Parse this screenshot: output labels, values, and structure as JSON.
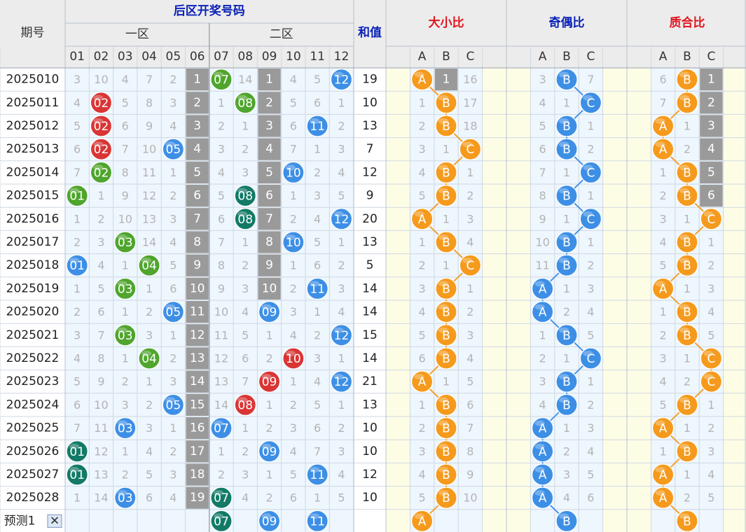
{
  "headers": {
    "period": "期号",
    "back_zone": "后区开奖号码",
    "zone1": "一区",
    "zone2": "二区",
    "sum": "和值",
    "size_ratio": "大小比",
    "parity_ratio": "奇偶比",
    "prime_ratio": "质合比",
    "numbers": [
      "01",
      "02",
      "03",
      "04",
      "05",
      "06",
      "07",
      "08",
      "09",
      "10",
      "11",
      "12"
    ],
    "abc": [
      "A",
      "B",
      "C"
    ]
  },
  "colors": {
    "blue": "#3d8fe6",
    "red": "#d93535",
    "green": "#4fa52d",
    "teal": "#127a66",
    "orange": "#f59a1c",
    "gray": "#9a9a9a"
  },
  "predict": {
    "label": "预测1",
    "close_symbol": "✕",
    "balls": [
      {
        "col": 7,
        "text": "07",
        "color": "teal"
      },
      {
        "col": 9,
        "text": "09",
        "color": "blue"
      },
      {
        "col": 11,
        "text": "11",
        "color": "blue"
      }
    ],
    "size": "A",
    "parity": "B",
    "prime": "B"
  },
  "chart_data": {
    "type": "table",
    "rows": [
      {
        "period": "2025010",
        "missing": [
          3,
          10,
          4,
          7,
          2,
          1,
          null,
          14,
          1,
          4,
          5,
          null
        ],
        "balls": [
          {
            "col": 7,
            "text": "07",
            "color": "green"
          },
          {
            "col": 12,
            "text": "12",
            "color": "blue"
          }
        ],
        "sum": 19,
        "size": {
          "pick": "A",
          "other": [
            1,
            16
          ]
        },
        "parity": {
          "pick": "B",
          "other": [
            3,
            7
          ]
        },
        "prime": {
          "pick": "B",
          "other": [
            6,
            1
          ]
        }
      },
      {
        "period": "2025011",
        "missing": [
          4,
          null,
          5,
          8,
          3,
          2,
          1,
          null,
          2,
          5,
          6,
          1
        ],
        "balls": [
          {
            "col": 2,
            "text": "02",
            "color": "red"
          },
          {
            "col": 8,
            "text": "08",
            "color": "green"
          }
        ],
        "sum": 10,
        "size": {
          "pick": "B",
          "other": [
            1,
            17
          ]
        },
        "parity": {
          "pick": "C",
          "other": [
            4,
            1
          ]
        },
        "prime": {
          "pick": "B",
          "other": [
            7,
            2
          ]
        }
      },
      {
        "period": "2025012",
        "missing": [
          5,
          null,
          6,
          9,
          4,
          3,
          2,
          1,
          3,
          6,
          null,
          2
        ],
        "balls": [
          {
            "col": 2,
            "text": "02",
            "color": "red"
          },
          {
            "col": 11,
            "text": "11",
            "color": "blue"
          }
        ],
        "sum": 13,
        "size": {
          "pick": "B",
          "other": [
            2,
            18
          ]
        },
        "parity": {
          "pick": "B",
          "other": [
            5,
            1
          ]
        },
        "prime": {
          "pick": "A",
          "other": [
            1,
            3
          ]
        }
      },
      {
        "period": "2025013",
        "missing": [
          6,
          null,
          7,
          10,
          null,
          4,
          3,
          2,
          4,
          7,
          1,
          3
        ],
        "balls": [
          {
            "col": 2,
            "text": "02",
            "color": "red"
          },
          {
            "col": 5,
            "text": "05",
            "color": "blue"
          }
        ],
        "sum": 7,
        "size": {
          "pick": "C",
          "other": [
            3,
            1
          ]
        },
        "parity": {
          "pick": "B",
          "other": [
            6,
            2
          ]
        },
        "prime": {
          "pick": "A",
          "other": [
            2,
            4
          ]
        }
      },
      {
        "period": "2025014",
        "missing": [
          7,
          null,
          8,
          11,
          1,
          5,
          4,
          3,
          5,
          null,
          2,
          4
        ],
        "balls": [
          {
            "col": 2,
            "text": "02",
            "color": "green"
          },
          {
            "col": 10,
            "text": "10",
            "color": "blue"
          }
        ],
        "sum": 12,
        "size": {
          "pick": "B",
          "other": [
            4,
            1
          ]
        },
        "parity": {
          "pick": "C",
          "other": [
            7,
            1
          ]
        },
        "prime": {
          "pick": "B",
          "other": [
            1,
            5
          ]
        }
      },
      {
        "period": "2025015",
        "missing": [
          null,
          1,
          9,
          12,
          2,
          6,
          5,
          null,
          6,
          1,
          3,
          5
        ],
        "balls": [
          {
            "col": 1,
            "text": "01",
            "color": "green"
          },
          {
            "col": 8,
            "text": "08",
            "color": "teal"
          }
        ],
        "sum": 9,
        "size": {
          "pick": "B",
          "other": [
            5,
            2
          ]
        },
        "parity": {
          "pick": "B",
          "other": [
            8,
            1
          ]
        },
        "prime": {
          "pick": "B",
          "other": [
            2,
            6
          ]
        }
      },
      {
        "period": "2025016",
        "missing": [
          1,
          2,
          10,
          13,
          3,
          7,
          6,
          null,
          7,
          2,
          4,
          null
        ],
        "balls": [
          {
            "col": 8,
            "text": "08",
            "color": "teal"
          },
          {
            "col": 12,
            "text": "12",
            "color": "blue"
          }
        ],
        "sum": 20,
        "size": {
          "pick": "A",
          "other": [
            1,
            3
          ]
        },
        "parity": {
          "pick": "C",
          "other": [
            9,
            1
          ]
        },
        "prime": {
          "pick": "C",
          "other": [
            3,
            1
          ]
        }
      },
      {
        "period": "2025017",
        "missing": [
          2,
          3,
          null,
          14,
          4,
          8,
          7,
          1,
          8,
          null,
          5,
          1
        ],
        "balls": [
          {
            "col": 3,
            "text": "03",
            "color": "green"
          },
          {
            "col": 10,
            "text": "10",
            "color": "blue"
          }
        ],
        "sum": 13,
        "size": {
          "pick": "B",
          "other": [
            1,
            4
          ]
        },
        "parity": {
          "pick": "B",
          "other": [
            10,
            1
          ]
        },
        "prime": {
          "pick": "B",
          "other": [
            4,
            1
          ]
        }
      },
      {
        "period": "2025018",
        "missing": [
          null,
          4,
          1,
          null,
          5,
          9,
          8,
          2,
          9,
          1,
          6,
          2
        ],
        "balls": [
          {
            "col": 1,
            "text": "01",
            "color": "blue"
          },
          {
            "col": 4,
            "text": "04",
            "color": "green"
          }
        ],
        "sum": 5,
        "size": {
          "pick": "C",
          "other": [
            2,
            1
          ]
        },
        "parity": {
          "pick": "B",
          "other": [
            11,
            2
          ]
        },
        "prime": {
          "pick": "B",
          "other": [
            5,
            2
          ]
        }
      },
      {
        "period": "2025019",
        "missing": [
          1,
          5,
          null,
          1,
          6,
          10,
          9,
          3,
          10,
          2,
          null,
          3
        ],
        "balls": [
          {
            "col": 3,
            "text": "03",
            "color": "green"
          },
          {
            "col": 11,
            "text": "11",
            "color": "blue"
          }
        ],
        "sum": 14,
        "size": {
          "pick": "B",
          "other": [
            3,
            1
          ]
        },
        "parity": {
          "pick": "A",
          "other": [
            1,
            3
          ]
        },
        "prime": {
          "pick": "A",
          "other": [
            1,
            3
          ]
        }
      },
      {
        "period": "2025020",
        "missing": [
          2,
          6,
          1,
          2,
          null,
          11,
          10,
          4,
          null,
          3,
          1,
          4
        ],
        "balls": [
          {
            "col": 5,
            "text": "05",
            "color": "blue"
          },
          {
            "col": 9,
            "text": "09",
            "color": "blue"
          }
        ],
        "sum": 14,
        "size": {
          "pick": "B",
          "other": [
            4,
            2
          ]
        },
        "parity": {
          "pick": "A",
          "other": [
            2,
            4
          ]
        },
        "prime": {
          "pick": "B",
          "other": [
            1,
            4
          ]
        }
      },
      {
        "period": "2025021",
        "missing": [
          3,
          7,
          null,
          3,
          1,
          12,
          11,
          5,
          1,
          4,
          2,
          null
        ],
        "balls": [
          {
            "col": 3,
            "text": "03",
            "color": "green"
          },
          {
            "col": 12,
            "text": "12",
            "color": "blue"
          }
        ],
        "sum": 15,
        "size": {
          "pick": "B",
          "other": [
            5,
            3
          ]
        },
        "parity": {
          "pick": "B",
          "other": [
            1,
            5
          ]
        },
        "prime": {
          "pick": "B",
          "other": [
            2,
            5
          ]
        }
      },
      {
        "period": "2025022",
        "missing": [
          4,
          8,
          1,
          null,
          2,
          13,
          12,
          6,
          2,
          null,
          3,
          1
        ],
        "balls": [
          {
            "col": 4,
            "text": "04",
            "color": "green"
          },
          {
            "col": 10,
            "text": "10",
            "color": "red"
          }
        ],
        "sum": 14,
        "size": {
          "pick": "B",
          "other": [
            6,
            4
          ]
        },
        "parity": {
          "pick": "C",
          "other": [
            2,
            1
          ]
        },
        "prime": {
          "pick": "C",
          "other": [
            3,
            1
          ]
        }
      },
      {
        "period": "2025023",
        "missing": [
          5,
          9,
          2,
          1,
          3,
          14,
          13,
          7,
          null,
          1,
          4,
          null
        ],
        "balls": [
          {
            "col": 9,
            "text": "09",
            "color": "red"
          },
          {
            "col": 12,
            "text": "12",
            "color": "blue"
          }
        ],
        "sum": 21,
        "size": {
          "pick": "A",
          "other": [
            1,
            5
          ]
        },
        "parity": {
          "pick": "B",
          "other": [
            3,
            1
          ]
        },
        "prime": {
          "pick": "C",
          "other": [
            4,
            2
          ]
        }
      },
      {
        "period": "2025024",
        "missing": [
          6,
          10,
          3,
          2,
          null,
          15,
          14,
          null,
          1,
          2,
          5,
          1
        ],
        "balls": [
          {
            "col": 5,
            "text": "05",
            "color": "blue"
          },
          {
            "col": 8,
            "text": "08",
            "color": "red"
          }
        ],
        "sum": 13,
        "size": {
          "pick": "B",
          "other": [
            1,
            6
          ]
        },
        "parity": {
          "pick": "B",
          "other": [
            4,
            2
          ]
        },
        "prime": {
          "pick": "B",
          "other": [
            5,
            1
          ]
        }
      },
      {
        "period": "2025025",
        "missing": [
          7,
          11,
          null,
          3,
          1,
          16,
          null,
          1,
          2,
          3,
          6,
          2
        ],
        "balls": [
          {
            "col": 3,
            "text": "03",
            "color": "blue"
          },
          {
            "col": 7,
            "text": "07",
            "color": "blue"
          }
        ],
        "sum": 10,
        "size": {
          "pick": "B",
          "other": [
            2,
            7
          ]
        },
        "parity": {
          "pick": "A",
          "other": [
            1,
            3
          ]
        },
        "prime": {
          "pick": "A",
          "other": [
            1,
            2
          ]
        }
      },
      {
        "period": "2025026",
        "missing": [
          null,
          12,
          1,
          4,
          2,
          17,
          1,
          2,
          null,
          4,
          7,
          3
        ],
        "balls": [
          {
            "col": 1,
            "text": "01",
            "color": "teal"
          },
          {
            "col": 9,
            "text": "09",
            "color": "blue"
          }
        ],
        "sum": 10,
        "size": {
          "pick": "B",
          "other": [
            3,
            8
          ]
        },
        "parity": {
          "pick": "A",
          "other": [
            2,
            4
          ]
        },
        "prime": {
          "pick": "B",
          "other": [
            1,
            3
          ]
        }
      },
      {
        "period": "2025027",
        "missing": [
          null,
          13,
          2,
          5,
          3,
          18,
          2,
          3,
          1,
          5,
          null,
          4
        ],
        "balls": [
          {
            "col": 1,
            "text": "01",
            "color": "teal"
          },
          {
            "col": 11,
            "text": "11",
            "color": "blue"
          }
        ],
        "sum": 12,
        "size": {
          "pick": "B",
          "other": [
            4,
            9
          ]
        },
        "parity": {
          "pick": "A",
          "other": [
            3,
            5
          ]
        },
        "prime": {
          "pick": "A",
          "other": [
            1,
            4
          ]
        }
      },
      {
        "period": "2025028",
        "missing": [
          1,
          14,
          null,
          6,
          4,
          19,
          null,
          4,
          2,
          6,
          1,
          5
        ],
        "balls": [
          {
            "col": 3,
            "text": "03",
            "color": "blue"
          },
          {
            "col": 7,
            "text": "07",
            "color": "teal"
          }
        ],
        "sum": 10,
        "size": {
          "pick": "B",
          "other": [
            5,
            10
          ]
        },
        "parity": {
          "pick": "A",
          "other": [
            4,
            6
          ]
        },
        "prime": {
          "pick": "A",
          "other": [
            2,
            5
          ]
        }
      }
    ]
  }
}
